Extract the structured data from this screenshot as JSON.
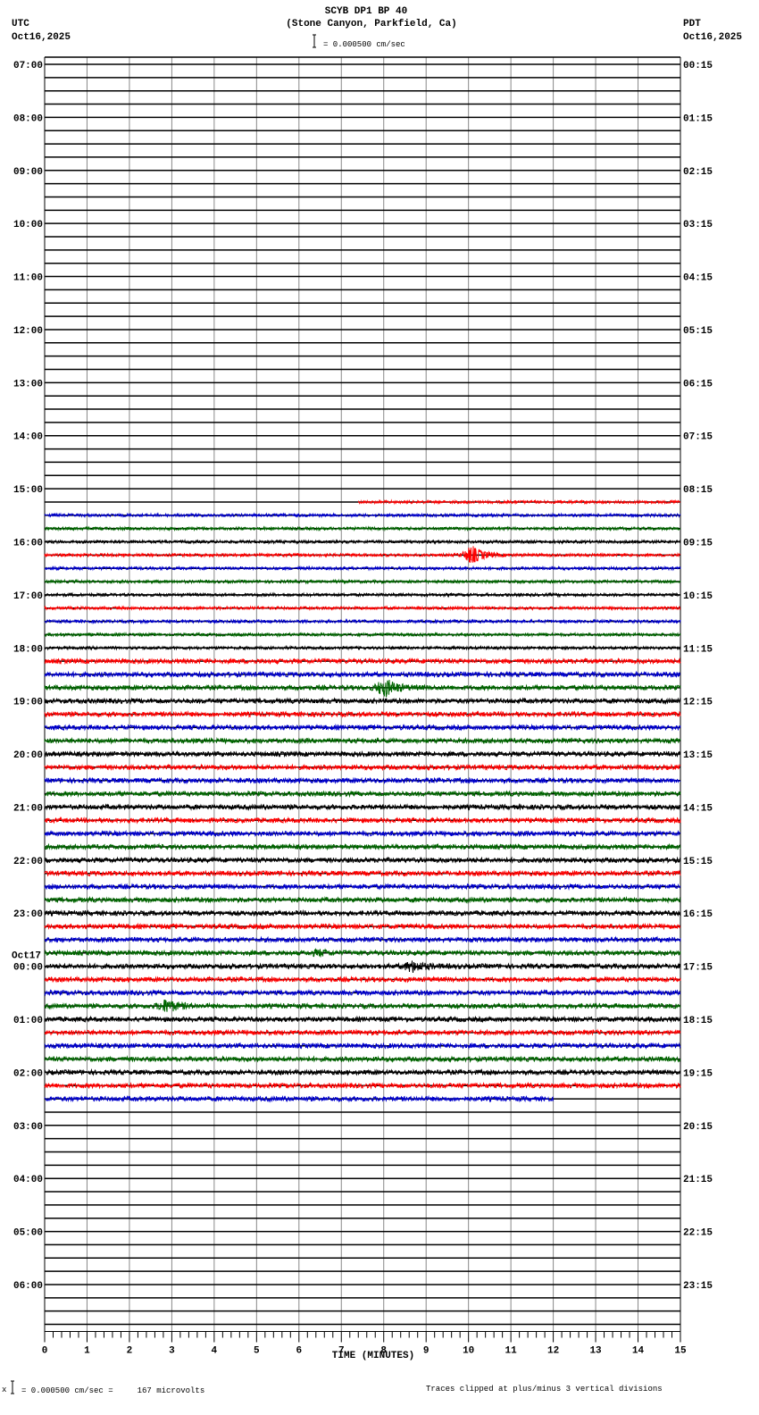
{
  "header": {
    "title": "SCYB DP1 BP 40",
    "subtitle": "(Stone Canyon, Parkfield, Ca)",
    "left_tz": "UTC",
    "left_date": "Oct16,2025",
    "right_tz": "PDT",
    "right_date": "Oct16,2025",
    "scale": "= 0.000500 cm/sec"
  },
  "footer": {
    "scale_prefix": "x",
    "scale": "= 0.000500 cm/sec =     167 microvolts",
    "clip_note": "Traces clipped at plus/minus 3 vertical divisions"
  },
  "chart_data": {
    "type": "helicorder",
    "title": "SCYB DP1 BP 40",
    "xlabel": "TIME (MINUTES)",
    "xlim": [
      0,
      15
    ],
    "x_ticks": [
      "0",
      "1",
      "2",
      "3",
      "4",
      "5",
      "6",
      "7",
      "8",
      "9",
      "10",
      "11",
      "12",
      "13",
      "14",
      "15"
    ],
    "rows_per_hour": 4,
    "total_rows": 96,
    "left_labels": [
      "07:00",
      "08:00",
      "09:00",
      "10:00",
      "11:00",
      "12:00",
      "13:00",
      "14:00",
      "15:00",
      "16:00",
      "17:00",
      "18:00",
      "19:00",
      "20:00",
      "21:00",
      "22:00",
      "23:00",
      "00:00",
      "01:00",
      "02:00",
      "03:00",
      "04:00",
      "05:00",
      "06:00"
    ],
    "date_change_label": "Oct17",
    "date_change_hour_index": 17,
    "right_labels": [
      "00:15",
      "01:15",
      "02:15",
      "03:15",
      "04:15",
      "05:15",
      "06:15",
      "07:15",
      "08:15",
      "09:15",
      "10:15",
      "11:15",
      "12:15",
      "13:15",
      "14:15",
      "15:15",
      "16:15",
      "17:15",
      "18:15",
      "19:15",
      "20:15",
      "21:15",
      "22:15",
      "23:15"
    ],
    "trace_colors": [
      "#000000",
      "#ff0000",
      "#0000cc",
      "#006600"
    ],
    "data_rows": {
      "first": 33,
      "last": 78,
      "first_start_min": 7.4,
      "last_end_min": 12.0
    },
    "events": [
      {
        "row": 37,
        "minute": 10.1,
        "amplitude": 9
      },
      {
        "row": 47,
        "minute": 8.05,
        "amplitude": 9
      },
      {
        "row": 67,
        "minute": 6.5,
        "amplitude": 2.5
      },
      {
        "row": 68,
        "minute": 8.7,
        "amplitude": 5
      },
      {
        "row": 71,
        "minute": 2.9,
        "amplitude": 6
      }
    ]
  }
}
